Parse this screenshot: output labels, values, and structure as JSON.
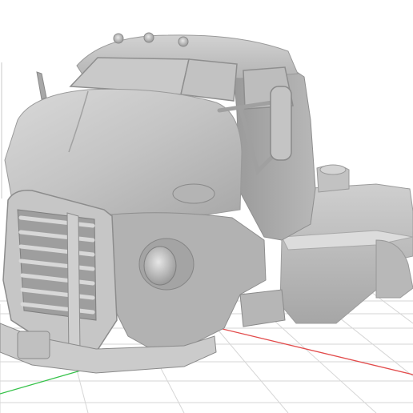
{
  "viewer": {
    "background": "#ffffff",
    "grid_color": "#d6d6d6",
    "axis_x_color": "#e24b4b",
    "axis_y_color": "#36c24a",
    "model_base_color": "#bdbdbd",
    "model_shadow_color": "#8c8c8c",
    "model_highlight_color": "#e4e4e4"
  }
}
